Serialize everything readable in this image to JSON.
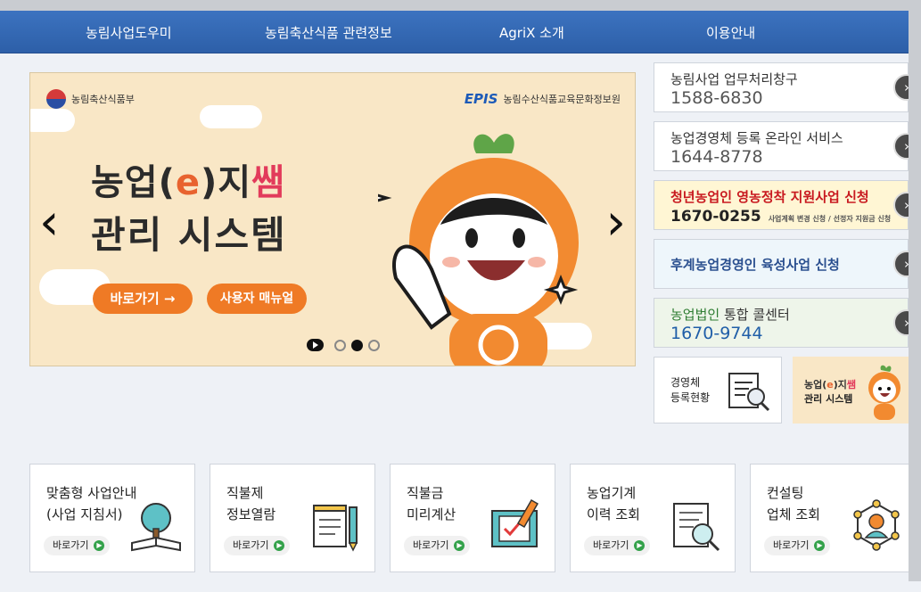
{
  "nav": [
    "농림사업도우미",
    "농림축산식품 관련정보",
    "AgriX 소개",
    "이용안내"
  ],
  "banner": {
    "gov_label": "농림축산식품부",
    "epis_logo": "EPIS",
    "epis_label": "농림수산식품교육문화정보원",
    "title_a": "농업(",
    "title_e": "e",
    "title_b": ")지",
    "title_ssam": "쌤",
    "title2": "관리 시스템",
    "btn_go": "바로가기 →",
    "btn_manual": "사용자 매뉴얼",
    "prev_arrow": "‹",
    "next_arrow": "›"
  },
  "services": [
    {
      "title": "농림사업 업무처리창구",
      "number": "1588-6830"
    },
    {
      "title": "농업경영체 등록 온라인 서비스",
      "number": "1644-8778"
    },
    {
      "title": "청년농업인 영농정착 지원사업 신청",
      "number": "1670-0255",
      "note": "사업계획 변경 신청 / 선정자 지원금 신청"
    },
    {
      "title": "후계농업경영인 육성사업 신청"
    },
    {
      "title_prefix": "농업법인",
      "title_suffix": " 통합 콜센터",
      "number": "1670-9744"
    }
  ],
  "mini": {
    "registry_line1": "경영체",
    "registry_line2": "등록현황",
    "promo_a": "농업(",
    "promo_e": "e",
    "promo_b": ")지",
    "promo_ssam": "쌤",
    "promo_line2": "관리 시스템"
  },
  "cards": [
    {
      "title": "맞춤형 사업안내\n(사업 지침서)",
      "button": "바로가기"
    },
    {
      "title": "직불제\n정보열람",
      "button": "바로가기"
    },
    {
      "title": "직불금\n미리계산",
      "button": "바로가기"
    },
    {
      "title": "농업기계\n이력 조회",
      "button": "바로가기"
    },
    {
      "title": "컨설팅\n업체 조회",
      "button": "바로가기"
    }
  ],
  "icons": {
    "go": "chevron-right-icon",
    "card_go": "play-circle-icon"
  },
  "colors": {
    "nav_bg": "#2d5fa8",
    "orange": "#ef7a25",
    "youth_bg": "#fff6d4",
    "successor_bg": "#eef6fb",
    "corp_bg": "#eef5ea"
  }
}
